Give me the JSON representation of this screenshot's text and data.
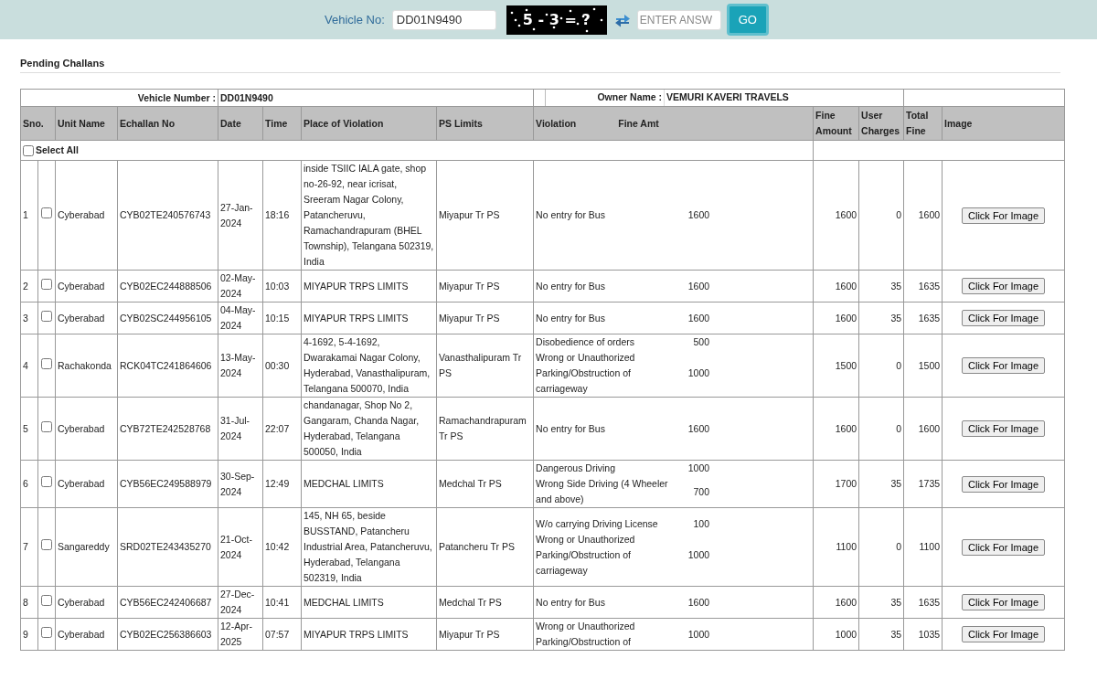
{
  "search": {
    "label": "Vehicle No:",
    "vehicle_no": "DD01N9490",
    "captcha": "5 - 3 = ?",
    "answer_placeholder": "ENTER ANSW",
    "go": "GO"
  },
  "section_title": "Pending Challans",
  "table": {
    "vehicle_label": "Vehicle Number :",
    "vehicle_value": "DD01N9490",
    "owner_label": "Owner Name :",
    "owner_value": "VEMURI KAVERI TRAVELS",
    "columns": [
      "Sno.",
      "Unit Name",
      "Echallan No",
      "Date",
      "Time",
      "Place of Violation",
      "PS Limits",
      "Violation",
      "Fine Amt",
      "Fine Amount",
      "User Charges",
      "Total Fine",
      "Image"
    ],
    "select_all": {
      "label": "Select All",
      "checked": false
    },
    "rows": [
      {
        "sno": "1",
        "checked": false,
        "unit": "Cyberabad",
        "echallan": "CYB02TE240576743",
        "date": "27-Jan-2024",
        "time": "18:16",
        "place": "inside TSIIC IALA gate, shop no-26-92, near icrisat, Sreeram Nagar Colony, Patancheruvu, Ramachandrapuram (BHEL Township), Telangana 502319, India",
        "ps": "Miyapur Tr PS",
        "violations": [
          {
            "text": "No entry for Bus",
            "amount": "1600"
          }
        ],
        "fine": "1600",
        "charges": "0",
        "total": "1600",
        "button": "Click For Image"
      },
      {
        "sno": "2",
        "checked": false,
        "unit": "Cyberabad",
        "echallan": "CYB02EC244888506",
        "date": "02-May-2024",
        "time": "10:03",
        "place": "MIYAPUR TRPS LIMITS",
        "ps": "Miyapur Tr PS",
        "violations": [
          {
            "text": "No entry for Bus",
            "amount": "1600"
          }
        ],
        "fine": "1600",
        "charges": "35",
        "total": "1635",
        "button": "Click For Image"
      },
      {
        "sno": "3",
        "checked": false,
        "unit": "Cyberabad",
        "echallan": "CYB02SC244956105",
        "date": "04-May-2024",
        "time": "10:15",
        "place": "MIYAPUR TRPS LIMITS",
        "ps": "Miyapur Tr PS",
        "violations": [
          {
            "text": "No entry for Bus",
            "amount": "1600"
          }
        ],
        "fine": "1600",
        "charges": "35",
        "total": "1635",
        "button": "Click For Image"
      },
      {
        "sno": "4",
        "checked": false,
        "unit": "Rachakonda",
        "echallan": "RCK04TC241864606",
        "date": "13-May-2024",
        "time": "00:30",
        "place": "4-1692, 5-4-1692, Dwarakamai Nagar Colony, Hyderabad, Vanasthalipuram, Telangana 500070, India",
        "ps": "Vanasthalipuram Tr PS",
        "violations": [
          {
            "text": "Disobedience of orders",
            "amount": "500"
          },
          {
            "text": "Wrong or Unauthorized Parking/Obstruction of carriageway",
            "amount": "1000"
          }
        ],
        "fine": "1500",
        "charges": "0",
        "total": "1500",
        "button": "Click For Image"
      },
      {
        "sno": "5",
        "checked": false,
        "unit": "Cyberabad",
        "echallan": "CYB72TE242528768",
        "date": "31-Jul-2024",
        "time": "22:07",
        "place": "chandanagar, Shop No 2, Gangaram, Chanda Nagar, Hyderabad, Telangana 500050, India",
        "ps": "Ramachandrapuram Tr PS",
        "violations": [
          {
            "text": "No entry for Bus",
            "amount": "1600"
          }
        ],
        "fine": "1600",
        "charges": "0",
        "total": "1600",
        "button": "Click For Image"
      },
      {
        "sno": "6",
        "checked": false,
        "unit": "Cyberabad",
        "echallan": "CYB56EC249588979",
        "date": "30-Sep-2024",
        "time": "12:49",
        "place": "MEDCHAL LIMITS",
        "ps": "Medchal Tr PS",
        "violations": [
          {
            "text": "Dangerous Driving",
            "amount": "1000"
          },
          {
            "text": "Wrong Side Driving (4 Wheeler and above)",
            "amount": "700"
          }
        ],
        "fine": "1700",
        "charges": "35",
        "total": "1735",
        "button": "Click For Image"
      },
      {
        "sno": "7",
        "checked": false,
        "unit": "Sangareddy",
        "echallan": "SRD02TE243435270",
        "date": "21-Oct-2024",
        "time": "10:42",
        "place": "145, NH 65, beside BUSSTAND, Patancheru Industrial Area, Patancheruvu, Hyderabad, Telangana 502319, India",
        "ps": "Patancheru Tr PS",
        "violations": [
          {
            "text": "W/o carrying Driving License",
            "amount": "100"
          },
          {
            "text": "Wrong or Unauthorized Parking/Obstruction of carriageway",
            "amount": "1000"
          }
        ],
        "fine": "1100",
        "charges": "0",
        "total": "1100",
        "button": "Click For Image"
      },
      {
        "sno": "8",
        "checked": false,
        "unit": "Cyberabad",
        "echallan": "CYB56EC242406687",
        "date": "27-Dec-2024",
        "time": "10:41",
        "place": "MEDCHAL LIMITS",
        "ps": "Medchal Tr PS",
        "violations": [
          {
            "text": "No entry for Bus",
            "amount": "1600"
          }
        ],
        "fine": "1600",
        "charges": "35",
        "total": "1635",
        "button": "Click For Image"
      },
      {
        "sno": "9",
        "checked": false,
        "unit": "Cyberabad",
        "echallan": "CYB02EC256386603",
        "date": "12-Apr-2025",
        "time": "07:57",
        "place": "MIYAPUR TRPS LIMITS",
        "ps": "Miyapur Tr PS",
        "violations": [
          {
            "text": "Wrong or Unauthorized Parking/Obstruction of",
            "amount": "1000"
          }
        ],
        "fine": "1000",
        "charges": "35",
        "total": "1035",
        "button": "Click For Image"
      }
    ]
  }
}
